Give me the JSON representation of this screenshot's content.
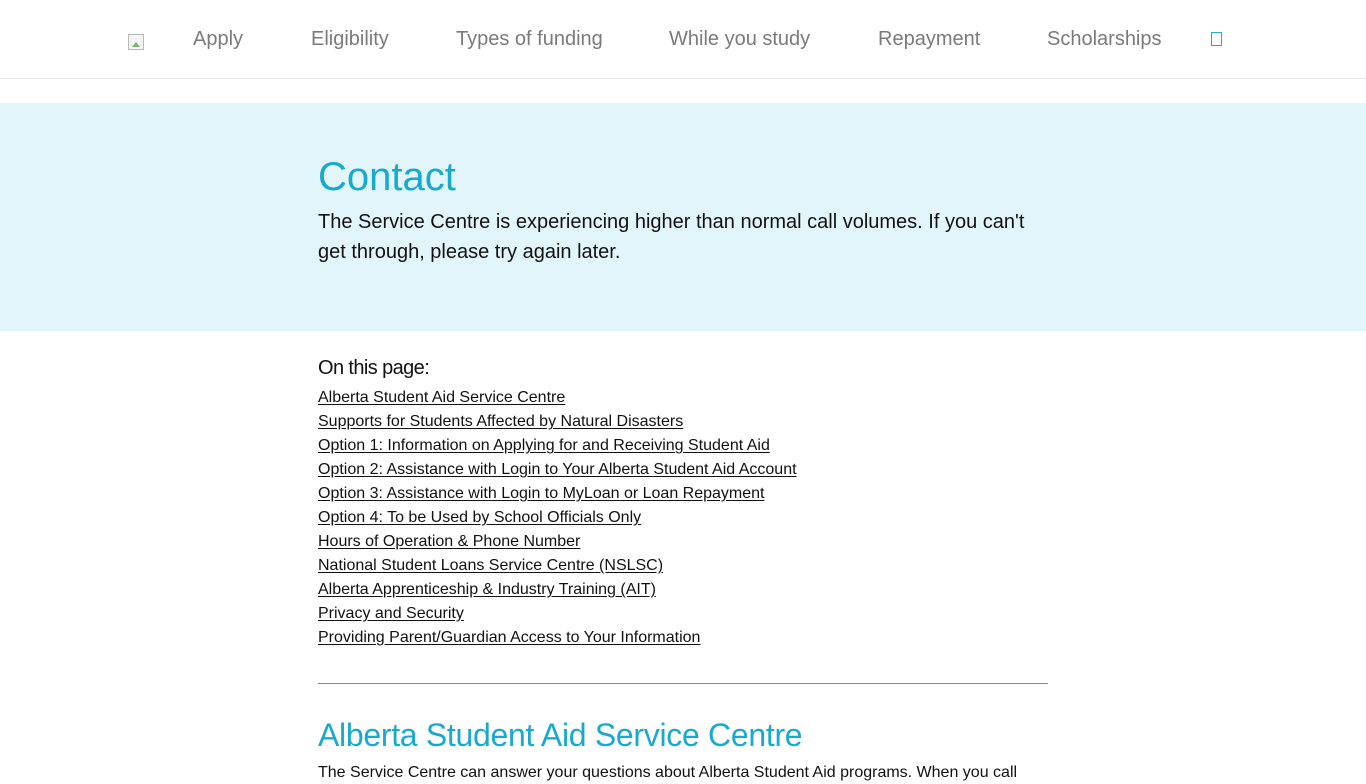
{
  "nav": {
    "items": [
      {
        "label": "Apply"
      },
      {
        "label": "Eligibility"
      },
      {
        "label": "Types of funding"
      },
      {
        "label": "While you study"
      },
      {
        "label": "Repayment"
      },
      {
        "label": "Scholarships"
      }
    ],
    "search_icon": "search-icon"
  },
  "colors": {
    "accent": "#17aacd",
    "hero_background": "#e2f5fa",
    "nav_text": "#7a7a7a"
  },
  "hero": {
    "title": "Contact",
    "message": "The Service Centre is experiencing higher than normal call volumes. If you can't get through, please try again later."
  },
  "toc": {
    "title": "On this page:",
    "links": [
      "Alberta Student Aid Service Centre",
      "Supports for Students Affected by Natural Disasters",
      "Option 1: Information on Applying for and Receiving Student Aid",
      "Option 2: Assistance with Login to Your Alberta Student Aid Account",
      "Option 3: Assistance with Login to MyLoan or Loan Repayment",
      "Option 4: To be Used by School Officials Only",
      "Hours of Operation & Phone Number",
      "National Student Loans Service Centre (NSLSC)",
      "Alberta Apprenticeship & Industry Training (AIT)",
      "Privacy and Security",
      "Providing Parent/Guardian Access to Your Information"
    ]
  },
  "section": {
    "title": "Alberta Student Aid Service Centre",
    "body": "The Service Centre can answer your questions about Alberta Student Aid programs. When you call"
  }
}
